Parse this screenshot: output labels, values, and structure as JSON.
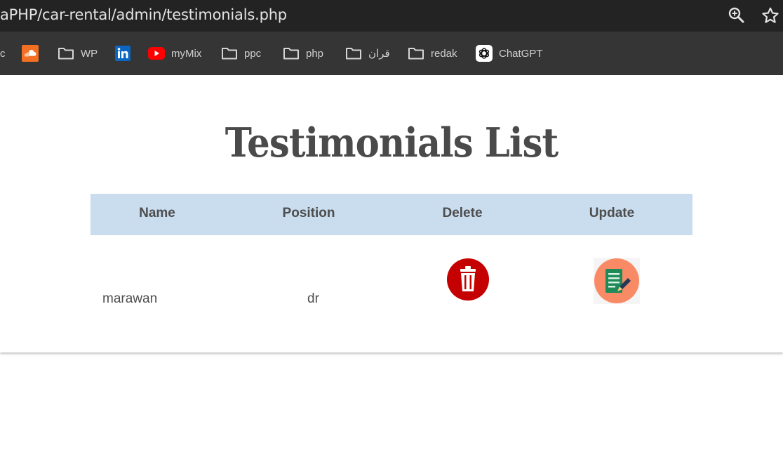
{
  "browser": {
    "url": "aPHP/car-rental/admin/testimonials.php",
    "bookmarks": [
      {
        "label": "c",
        "icon": "folder-icon"
      },
      {
        "label": "",
        "icon": "soundcloud-icon"
      },
      {
        "label": "WP",
        "icon": "folder-icon"
      },
      {
        "label": "",
        "icon": "linkedin-icon"
      },
      {
        "label": "myMix",
        "icon": "youtube-icon"
      },
      {
        "label": "ppc",
        "icon": "folder-icon"
      },
      {
        "label": "php",
        "icon": "folder-icon"
      },
      {
        "label": "قران",
        "icon": "folder-icon"
      },
      {
        "label": "redak",
        "icon": "folder-icon"
      },
      {
        "label": "ChatGPT",
        "icon": "chatgpt-icon"
      }
    ]
  },
  "page": {
    "title": "Testimonials List",
    "table": {
      "headers": [
        "Name",
        "Position",
        "Delete",
        "Update"
      ],
      "rows": [
        {
          "name": "marawan",
          "position": "dr",
          "delete_icon": "trash-icon",
          "update_icon": "edit-document-icon"
        }
      ]
    }
  },
  "colors": {
    "header_bg": "#c9ddee",
    "text": "#4d4d4d",
    "delete_red": "#c40000",
    "update_orange": "#f98a66"
  }
}
